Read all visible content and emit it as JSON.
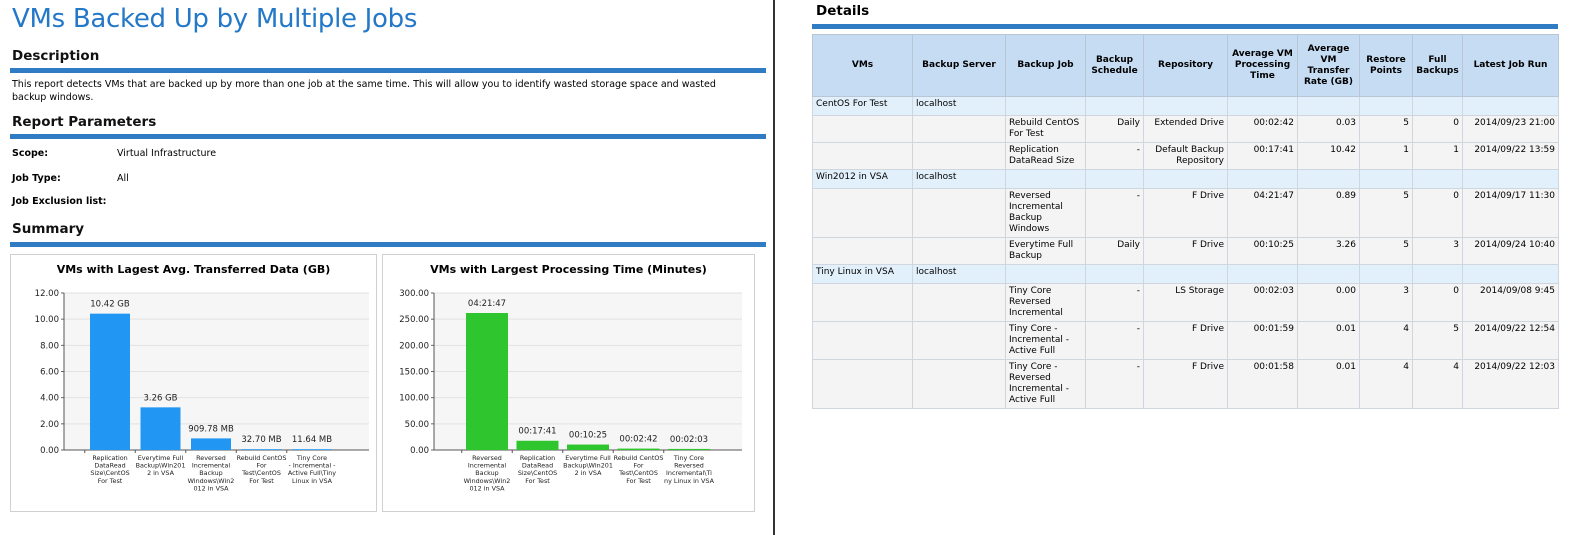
{
  "report": {
    "title": "VMs Backed Up by Multiple Jobs",
    "description_heading": "Description",
    "description": "This report detects VMs that are backed up by more than one job at the same time. This will allow you to identify wasted storage space and wasted backup windows.",
    "parameters_heading": "Report Parameters",
    "parameters": [
      {
        "label": "Scope:",
        "value": "Virtual Infrastructure"
      },
      {
        "label": "Job Type:",
        "value": "All"
      },
      {
        "label": "Job Exclusion list:",
        "value": ""
      }
    ],
    "summary_heading": "Summary",
    "details_heading": "Details"
  },
  "chart_data": [
    {
      "type": "bar",
      "title": "VMs with Lagest Avg. Transferred Data (GB)",
      "categories": [
        [
          "Replication",
          "DataRead",
          "Size\\CentOS",
          "For Test"
        ],
        [
          "Everytime Full",
          "Backup\\Win201",
          "2 in VSA"
        ],
        [
          "Reversed",
          "Incremental",
          "Backup",
          "Windows\\Win2",
          "012 in VSA"
        ],
        [
          "Rebuild CentOS",
          "For",
          "Test\\CentOS",
          "For Test"
        ],
        [
          "Tiny Core",
          "- Incremental -",
          "Active Full\\Tiny",
          "Linux in VSA"
        ]
      ],
      "values": [
        10.42,
        3.26,
        0.888,
        0.032,
        0.011
      ],
      "value_labels": [
        "10.42 GB",
        "3.26 GB",
        "909.78 MB",
        "32.70 MB",
        "11.64 MB"
      ],
      "yticks": [
        "0.00",
        "2.00",
        "4.00",
        "6.00",
        "8.00",
        "10.00",
        "12.00"
      ],
      "ylim": [
        0,
        12
      ],
      "color": "#2196f3",
      "grid": true
    },
    {
      "type": "bar",
      "title": "VMs with Largest Processing Time (Minutes)",
      "categories": [
        [
          "Reversed",
          "Incremental",
          "Backup",
          "Windows\\Win2",
          "012 in VSA"
        ],
        [
          "Replication",
          "DataRead",
          "Size\\CentOS",
          "For Test"
        ],
        [
          "Everytime Full",
          "Backup\\Win201",
          "2 in VSA"
        ],
        [
          "Rebuild CentOS",
          "For",
          "Test\\CentOS",
          "For Test"
        ],
        [
          "Tiny Core",
          "Reversed",
          "Incremental\\Ti",
          "ny Linux in VSA"
        ]
      ],
      "values": [
        261.78,
        17.68,
        10.42,
        2.7,
        2.05
      ],
      "value_labels": [
        "04:21:47",
        "00:17:41",
        "00:10:25",
        "00:02:42",
        "00:02:03"
      ],
      "yticks": [
        "0.00",
        "50.00",
        "100.00",
        "150.00",
        "200.00",
        "250.00",
        "300.00"
      ],
      "ylim": [
        0,
        300
      ],
      "color": "#2ec52e",
      "grid": true
    }
  ],
  "details": {
    "headers": [
      "VMs",
      "Backup Server",
      "Backup Job",
      "Backup Schedule",
      "Repository",
      "Average VM Processing Time",
      "Average VM Transfer Rate (GB)",
      "Restore Points",
      "Full Backups",
      "Latest Job Run"
    ],
    "groups": [
      {
        "vm": "CentOS For Test",
        "server": "localhost",
        "jobs": [
          {
            "job": "Rebuild CentOS For Test",
            "schedule": "Daily",
            "repository": "Extended Drive",
            "time": "00:02:42",
            "rate": "0.03",
            "restore": "5",
            "full": "0",
            "latest": "2014/09/23 21:00"
          },
          {
            "job": "Replication DataRead Size",
            "schedule": "-",
            "repository": "Default Backup Repository",
            "time": "00:17:41",
            "rate": "10.42",
            "restore": "1",
            "full": "1",
            "latest": "2014/09/22 13:59"
          }
        ]
      },
      {
        "vm": "Win2012 in VSA",
        "server": "localhost",
        "jobs": [
          {
            "job": "Reversed Incremental Backup Windows",
            "schedule": "-",
            "repository": "F Drive",
            "time": "04:21:47",
            "rate": "0.89",
            "restore": "5",
            "full": "0",
            "latest": "2014/09/17 11:30"
          },
          {
            "job": "Everytime Full Backup",
            "schedule": "Daily",
            "repository": "F Drive",
            "time": "00:10:25",
            "rate": "3.26",
            "restore": "5",
            "full": "3",
            "latest": "2014/09/24 10:40"
          }
        ]
      },
      {
        "vm": "Tiny Linux in VSA",
        "server": "localhost",
        "jobs": [
          {
            "job": "Tiny Core Reversed Incremental",
            "schedule": "-",
            "repository": "LS Storage",
            "time": "00:02:03",
            "rate": "0.00",
            "restore": "3",
            "full": "0",
            "latest": "2014/09/08 9:45"
          },
          {
            "job": "Tiny Core - Incremental - Active Full",
            "schedule": "-",
            "repository": "F Drive",
            "time": "00:01:59",
            "rate": "0.01",
            "restore": "4",
            "full": "5",
            "latest": "2014/09/22 12:54"
          },
          {
            "job": "Tiny Core - Reversed Incremental - Active Full",
            "schedule": "-",
            "repository": "F Drive",
            "time": "00:01:58",
            "rate": "0.01",
            "restore": "4",
            "full": "4",
            "latest": "2014/09/22 12:03"
          }
        ]
      }
    ]
  }
}
